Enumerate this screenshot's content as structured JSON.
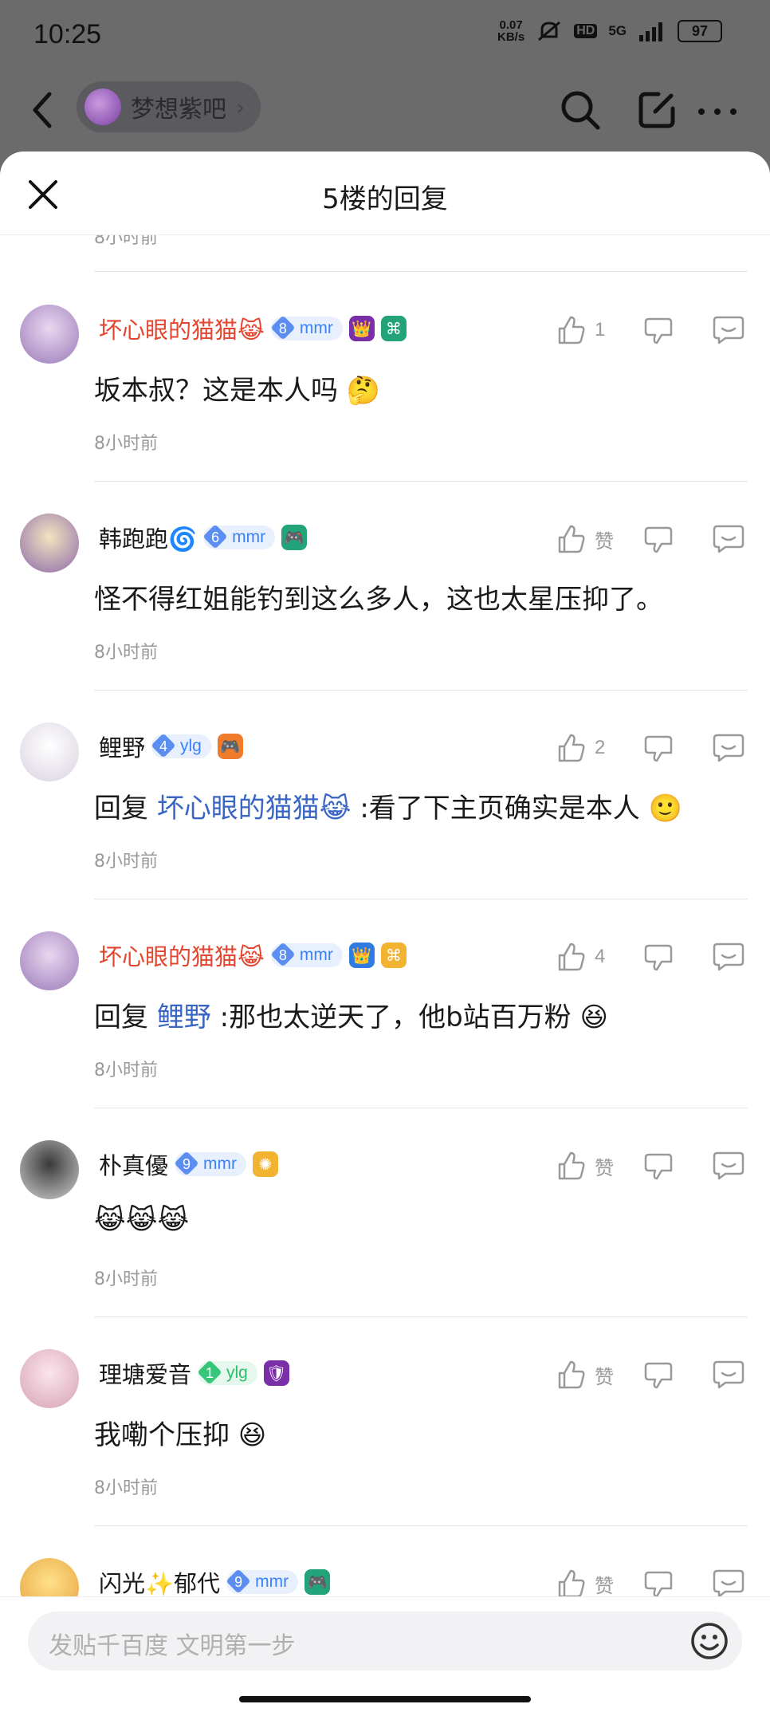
{
  "status": {
    "time": "10:25",
    "net_speed_top": "0.07",
    "net_speed_unit": "KB/s",
    "hd": "HD",
    "signal": "5G",
    "battery": "97"
  },
  "topbar": {
    "forum_name": "梦想紫吧",
    "forum_chevron": "›",
    "search_icon": "search-icon",
    "edit_icon": "edit-icon",
    "more_icon": "more-icon"
  },
  "sheet": {
    "title": "5楼的回复",
    "prev_time": "8小时前"
  },
  "comments": [
    {
      "name": "坏心眼的猫猫😹",
      "name_color": "#e4452f",
      "level": "8",
      "tag": "mmr",
      "badges": [
        "👑",
        "⌘"
      ],
      "likes": "1",
      "content_text": "坂本叔？这是本人吗 🤔",
      "reply_prefix": "",
      "reply_to": "",
      "time": "8小时前"
    },
    {
      "name": "韩跑跑🌀",
      "name_color": "#1a1a1a",
      "level": "6",
      "tag": "mmr",
      "badges": [
        "🎮"
      ],
      "likes": "赞",
      "content_text": "怪不得红姐能钓到这么多人，这也太星压抑了。",
      "reply_prefix": "",
      "reply_to": "",
      "time": "8小时前"
    },
    {
      "name": "鲤野",
      "name_color": "#1a1a1a",
      "level": "4",
      "tag": "ylg",
      "badges": [
        "🎮"
      ],
      "likes": "2",
      "content_text": " :看了下主页确实是本人 🙂",
      "reply_prefix": "回复 ",
      "reply_to": "坏心眼的猫猫😹",
      "time": "8小时前"
    },
    {
      "name": "坏心眼的猫猫😹",
      "name_color": "#e4452f",
      "level": "8",
      "tag": "mmr",
      "badges": [
        "👑",
        "⌘"
      ],
      "likes": "4",
      "content_text": " :那也太逆天了，他b站百万粉 😆",
      "reply_prefix": "回复 ",
      "reply_to": "鲤野",
      "time": "8小时前"
    },
    {
      "name": "朴真優",
      "name_color": "#1a1a1a",
      "level": "9",
      "tag": "mmr",
      "badges": [
        "✺"
      ],
      "likes": "赞",
      "content_text": "😹😹😹",
      "reply_prefix": "",
      "reply_to": "",
      "time": "8小时前"
    },
    {
      "name": "理塘爱音",
      "name_color": "#1a1a1a",
      "level": "1",
      "tag": "ylg",
      "badges": [
        "🛡"
      ],
      "likes": "赞",
      "content_text": "我嘞个压抑 😆",
      "reply_prefix": "",
      "reply_to": "",
      "time": "8小时前"
    },
    {
      "name": "闪光✨郁代",
      "name_color": "#1a1a1a",
      "level": "9",
      "tag": "mmr",
      "badges": [
        "🎮"
      ],
      "likes": "赞",
      "content_text": "",
      "reply_prefix": "",
      "reply_to": "",
      "time": ""
    }
  ],
  "input": {
    "placeholder": "发贴千百度 文明第一步"
  }
}
